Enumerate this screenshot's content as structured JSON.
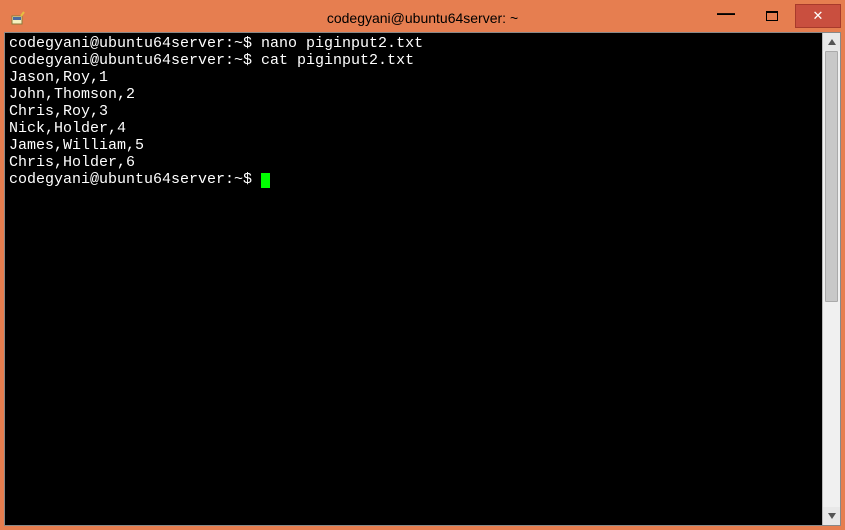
{
  "window": {
    "title": "codegyani@ubuntu64server: ~"
  },
  "terminal": {
    "prompt": "codegyani@ubuntu64server:~$",
    "lines": [
      {
        "prompt": true,
        "cmd": "nano piginput2.txt"
      },
      {
        "prompt": true,
        "cmd": "cat piginput2.txt"
      },
      {
        "prompt": false,
        "text": "Jason,Roy,1"
      },
      {
        "prompt": false,
        "text": "John,Thomson,2"
      },
      {
        "prompt": false,
        "text": "Chris,Roy,3"
      },
      {
        "prompt": false,
        "text": "Nick,Holder,4"
      },
      {
        "prompt": false,
        "text": "James,William,5"
      },
      {
        "prompt": false,
        "text": "Chris,Holder,6"
      },
      {
        "prompt": true,
        "cmd": "",
        "cursor": true
      }
    ]
  },
  "controls": {
    "minimize": "—",
    "close": "✕"
  }
}
